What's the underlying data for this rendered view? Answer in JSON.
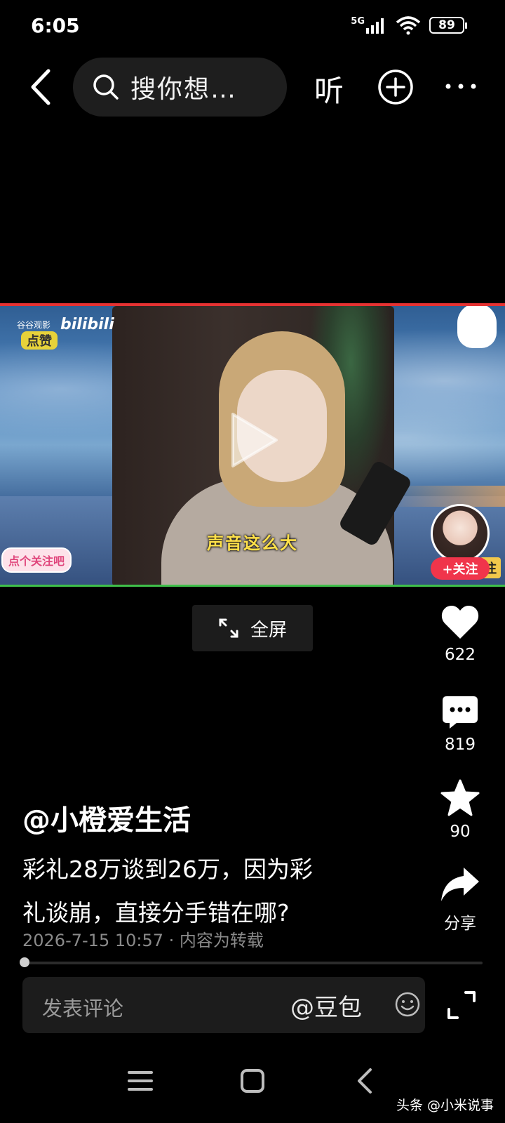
{
  "status_bar": {
    "time": "6:05",
    "network": "5G",
    "battery": "89"
  },
  "top_bar": {
    "search_text": "搜你想…",
    "listen_label": "听"
  },
  "video": {
    "subtitle": "声音这么大",
    "wm_label": "谷谷观影",
    "wm_brand": "bilibili",
    "wm_like": "点赞",
    "follow_sticker": "点个关注吧",
    "corner_tag": "注",
    "avatar_follow": "+关注"
  },
  "fullscreen_label": "全屏",
  "actions": {
    "like_count": "622",
    "comment_count": "819",
    "favorite_count": "90",
    "share_label": "分享"
  },
  "post": {
    "author": "@小橙爱生活",
    "desc_line1": "彩礼28万谈到26万，因为彩",
    "desc_line2": "礼谈崩，直接分手错在哪?",
    "meta": "2026-7-15 10:57 · 内容为转载"
  },
  "progress": {
    "fraction": 0.01
  },
  "comment": {
    "placeholder": "发表评论",
    "mention": "@豆包"
  },
  "watermark": "头条 @小米说事"
}
